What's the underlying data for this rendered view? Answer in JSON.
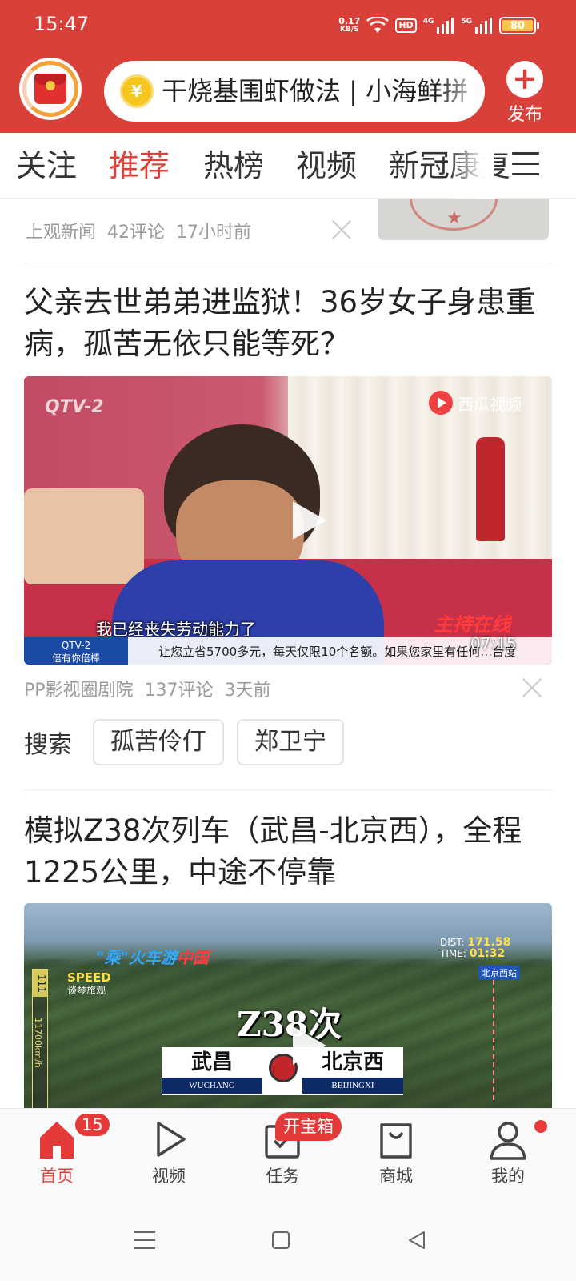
{
  "status_bar": {
    "time": "15:47",
    "net_speed": "0.17",
    "net_unit": "KB/S",
    "hd": "HD",
    "sig1": "4G",
    "sig2": "5G",
    "battery": "80"
  },
  "header": {
    "search_text": "干烧基围虾做法 | 小海鲜拼",
    "coin_symbol": "¥",
    "publish_label": "发布"
  },
  "tabs": [
    {
      "label": "关注"
    },
    {
      "label": "推荐"
    },
    {
      "label": "热榜"
    },
    {
      "label": "视频"
    },
    {
      "label": "新冠康复"
    }
  ],
  "feed": {
    "item0": {
      "source": "上观新闻",
      "comments": "42评论",
      "time": "17小时前"
    },
    "item1": {
      "title": "父亲去世弟弟进监狱！36岁女子身患重病，孤苦无依只能等死？",
      "video": {
        "watermark": "QTV-2",
        "platform": "西瓜视频",
        "subtitle": "我已经丧失劳动能力了",
        "channel_tag_1": "QTV-2",
        "channel_tag_2": "倍有你倍棒",
        "ticker": "让您立省5700多元，每天仅限10个名额。如果您家里有任何…台度",
        "brand_right": "主持在线",
        "duration": "07:15"
      },
      "source": "PP影视圈剧院",
      "comments": "137评论",
      "time": "3天前"
    },
    "search_row": {
      "label": "搜索",
      "chips": [
        "孤苦伶仃",
        "郑卫宁"
      ]
    },
    "item2": {
      "title": "模拟Z38次列车（武昌-北京西），全程1225公里，中途不停靠",
      "video": {
        "brand_a": "\"乘\"火车",
        "brand_b": "游",
        "brand_c": "中国",
        "speed_label": "SPEED",
        "speed_sub": "谈琴旅观",
        "gauge_value": "111",
        "gauge_label": "11700km/h",
        "big_title": "Z38次",
        "station_from": "武昌",
        "station_from_pinyin": "WUCHANG",
        "station_to": "北京西",
        "station_to_pinyin": "BEIJINGXI",
        "dist_label": "DIST:",
        "dist_value": "171.58",
        "time_label": "TIME:",
        "time_value": "01:32",
        "map_pin": "北京西站"
      }
    }
  },
  "bottom_nav": {
    "items": [
      {
        "label": "首页"
      },
      {
        "label": "视频"
      },
      {
        "label": "任务"
      },
      {
        "label": "商城"
      },
      {
        "label": "我的"
      }
    ],
    "home_badge": "15",
    "task_badge": "开宝箱"
  },
  "colors": {
    "brand_red": "#d9403a",
    "active_tab": "#e0403a",
    "badge": "#e5393a"
  }
}
